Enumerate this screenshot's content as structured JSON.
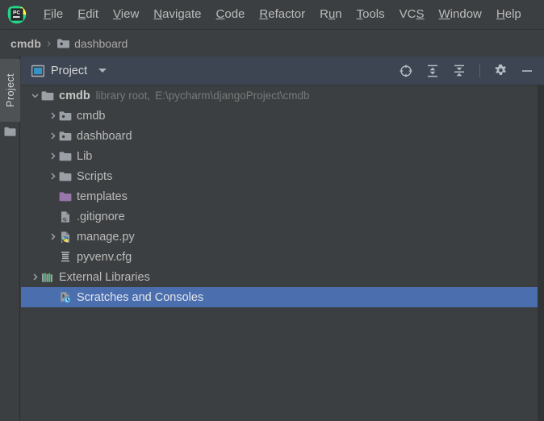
{
  "app": {
    "logo_icon": "pycharm-logo-icon"
  },
  "menubar": {
    "items": [
      {
        "label": "File",
        "mnemonic": "F",
        "rest": "ile"
      },
      {
        "label": "Edit",
        "mnemonic": "E",
        "rest": "dit"
      },
      {
        "label": "View",
        "mnemonic": "V",
        "rest": "iew"
      },
      {
        "label": "Navigate",
        "mnemonic": "N",
        "rest": "avigate"
      },
      {
        "label": "Code",
        "mnemonic": "C",
        "rest": "ode"
      },
      {
        "label": "Refactor",
        "mnemonic": "R",
        "rest": "efactor"
      },
      {
        "label": "Run",
        "pre": "R",
        "mnemonic": "u",
        "rest": "n"
      },
      {
        "label": "Tools",
        "mnemonic": "T",
        "rest": "ools"
      },
      {
        "label": "VCS",
        "pre": "VC",
        "mnemonic": "S",
        "rest": ""
      },
      {
        "label": "Window",
        "mnemonic": "W",
        "rest": "indow"
      },
      {
        "label": "Help",
        "mnemonic": "H",
        "rest": "elp"
      }
    ]
  },
  "breadcrumb": {
    "root": "cmdb",
    "separator": "›",
    "leaf": "dashboard",
    "leaf_icon": "folder-module-icon"
  },
  "left_strip": {
    "tab_label": "Project",
    "tab_icon": "folder-icon"
  },
  "panel_toolbar": {
    "title": "Project",
    "title_icon": "project-view-icon",
    "dropdown_icon": "chevron-down-icon",
    "buttons": [
      {
        "name": "select-opened-file-button",
        "icon": "target-icon",
        "tooltip": "Select Opened File"
      },
      {
        "name": "expand-all-button",
        "icon": "expand-all-icon",
        "tooltip": "Expand All"
      },
      {
        "name": "collapse-all-button",
        "icon": "collapse-all-icon",
        "tooltip": "Collapse All"
      },
      {
        "name": "settings-button",
        "icon": "gear-icon",
        "tooltip": "Settings"
      },
      {
        "name": "hide-button",
        "icon": "minimize-icon",
        "tooltip": "Hide"
      }
    ]
  },
  "tree": {
    "rows": [
      {
        "name": "tree-row-cmdb-root",
        "label": "cmdb",
        "meta": "library root,",
        "meta2": "E:\\pycharm\\djangoProject\\cmdb",
        "icon": "folder-icon",
        "indent": 0,
        "arrow": "expanded",
        "bold": true,
        "selected": false
      },
      {
        "name": "tree-row-cmdb",
        "label": "cmdb",
        "icon": "folder-module-icon",
        "indent": 1,
        "arrow": "collapsed",
        "bold": false,
        "selected": false
      },
      {
        "name": "tree-row-dashboard",
        "label": "dashboard",
        "icon": "folder-module-icon",
        "indent": 1,
        "arrow": "collapsed",
        "bold": false,
        "selected": false
      },
      {
        "name": "tree-row-lib",
        "label": "Lib",
        "icon": "folder-icon",
        "indent": 1,
        "arrow": "collapsed",
        "bold": false,
        "selected": false
      },
      {
        "name": "tree-row-scripts",
        "label": "Scripts",
        "icon": "folder-icon",
        "indent": 1,
        "arrow": "collapsed",
        "bold": false,
        "selected": false
      },
      {
        "name": "tree-row-templates",
        "label": "templates",
        "icon": "folder-template-icon",
        "indent": 1,
        "arrow": "none",
        "bold": false,
        "selected": false
      },
      {
        "name": "tree-row-gitignore",
        "label": ".gitignore",
        "icon": "file-ignored-icon",
        "indent": 1,
        "arrow": "none",
        "bold": false,
        "selected": false
      },
      {
        "name": "tree-row-manage-py",
        "label": "manage.py",
        "icon": "python-file-icon",
        "indent": 1,
        "arrow": "collapsed",
        "bold": false,
        "selected": false
      },
      {
        "name": "tree-row-pyvenv-cfg",
        "label": "pyvenv.cfg",
        "icon": "config-file-icon",
        "indent": 1,
        "arrow": "none",
        "bold": false,
        "selected": false
      },
      {
        "name": "tree-row-external-libraries",
        "label": "External Libraries",
        "icon": "libraries-icon",
        "indent": 0,
        "arrow": "collapsed",
        "bold": false,
        "selected": false
      },
      {
        "name": "tree-row-scratches-and-consoles",
        "label": "Scratches and Consoles",
        "icon": "scratches-icon",
        "indent": 0,
        "arrow": "none",
        "bold": false,
        "selected": true
      }
    ]
  },
  "colors": {
    "background": "#3c3f41",
    "toolbar_background": "#3c4551",
    "selection": "#4b6eaf",
    "text": "#bbbbbb",
    "muted_text": "#787878",
    "template_folder": "#9876aa",
    "python_yellow": "#f4d03f",
    "python_blue": "#4b8bbe"
  }
}
